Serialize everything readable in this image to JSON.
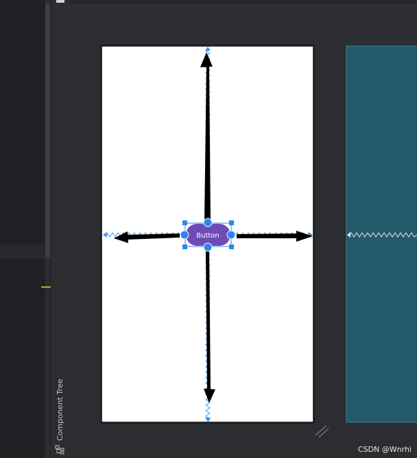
{
  "button": {
    "label": "Button"
  },
  "sidebar": {
    "component_tree_label": "Component Tree"
  },
  "watermark": {
    "text": "CSDN @Wnrhi"
  },
  "colors": {
    "editor_bg": "#2b2d30",
    "left_panel": "#1f2124",
    "design_surface": "#ffffff",
    "blueprint_surface": "#245a6c",
    "button_fill": "#6e4cb8",
    "selection": "#2f86ea",
    "constraint": "#3a93e6",
    "arrow": "#000000"
  },
  "icons": {
    "tree": "component-tree-icon",
    "resize": "resize-handle-icon"
  }
}
